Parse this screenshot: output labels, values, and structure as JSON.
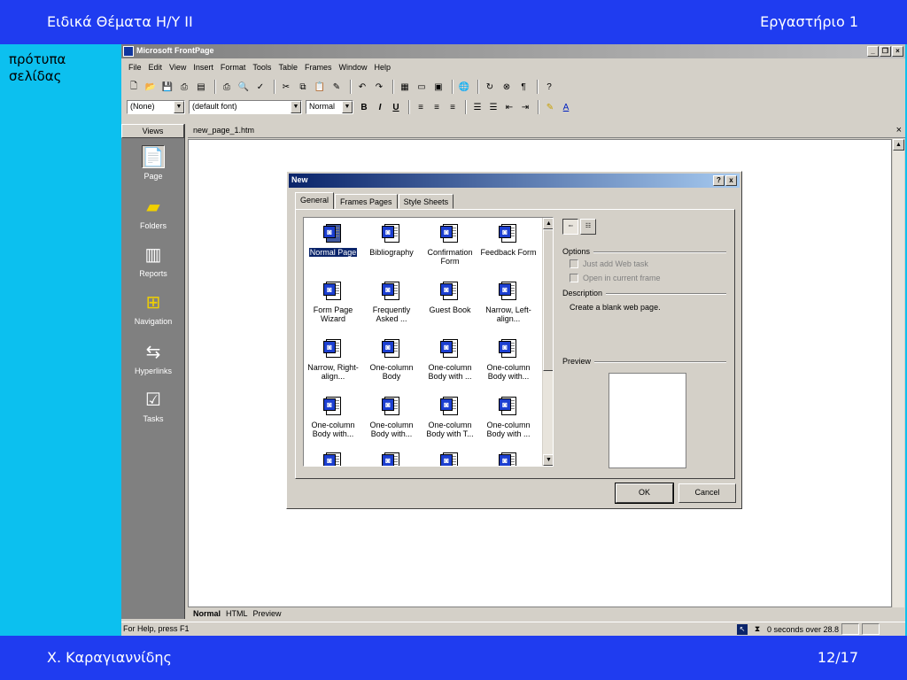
{
  "slide": {
    "header_left": "Ειδικά Θέματα Η/Υ ΙΙ",
    "header_right": "Εργαστήριο 1",
    "side_label": "πρότυπα σελίδας",
    "footer_left": "Χ. Καραγιαννίδης",
    "footer_right": "12/17"
  },
  "app": {
    "title": "Microsoft FrontPage",
    "menu": [
      "File",
      "Edit",
      "View",
      "Insert",
      "Format",
      "Tools",
      "Table",
      "Frames",
      "Window",
      "Help"
    ],
    "style_combo": "(None)",
    "font_combo": "(default font)",
    "size_combo": "Normal",
    "document_tab": "new_page_1.htm",
    "views_header": "Views",
    "views": [
      "Page",
      "Folders",
      "Reports",
      "Navigation",
      "Hyperlinks",
      "Tasks"
    ],
    "bottom_tabs": [
      "Normal",
      "HTML",
      "Preview"
    ],
    "status_left": "For Help, press F1",
    "status_right": "0 seconds over 28.8"
  },
  "dialog": {
    "title": "New",
    "help_btn": "?",
    "close_btn": "x",
    "tabs": [
      "General",
      "Frames Pages",
      "Style Sheets"
    ],
    "templates": [
      "Normal Page",
      "Bibliography",
      "Confirmation Form",
      "Feedback Form",
      "Form Page Wizard",
      "Frequently Asked ...",
      "Guest Book",
      "Narrow, Left-align...",
      "Narrow, Right-align...",
      "One-column Body",
      "One-column Body with ...",
      "One-column Body with...",
      "One-column Body with...",
      "One-column Body with...",
      "One-column Body with T...",
      "One-column Body with ...",
      "",
      "",
      "",
      ""
    ],
    "options_label": "Options",
    "option_add_web_task": "Just add Web task",
    "option_open_current_frame": "Open in current frame",
    "description_label": "Description",
    "description_text": "Create a blank web page.",
    "preview_label": "Preview",
    "ok_label": "OK",
    "cancel_label": "Cancel"
  }
}
